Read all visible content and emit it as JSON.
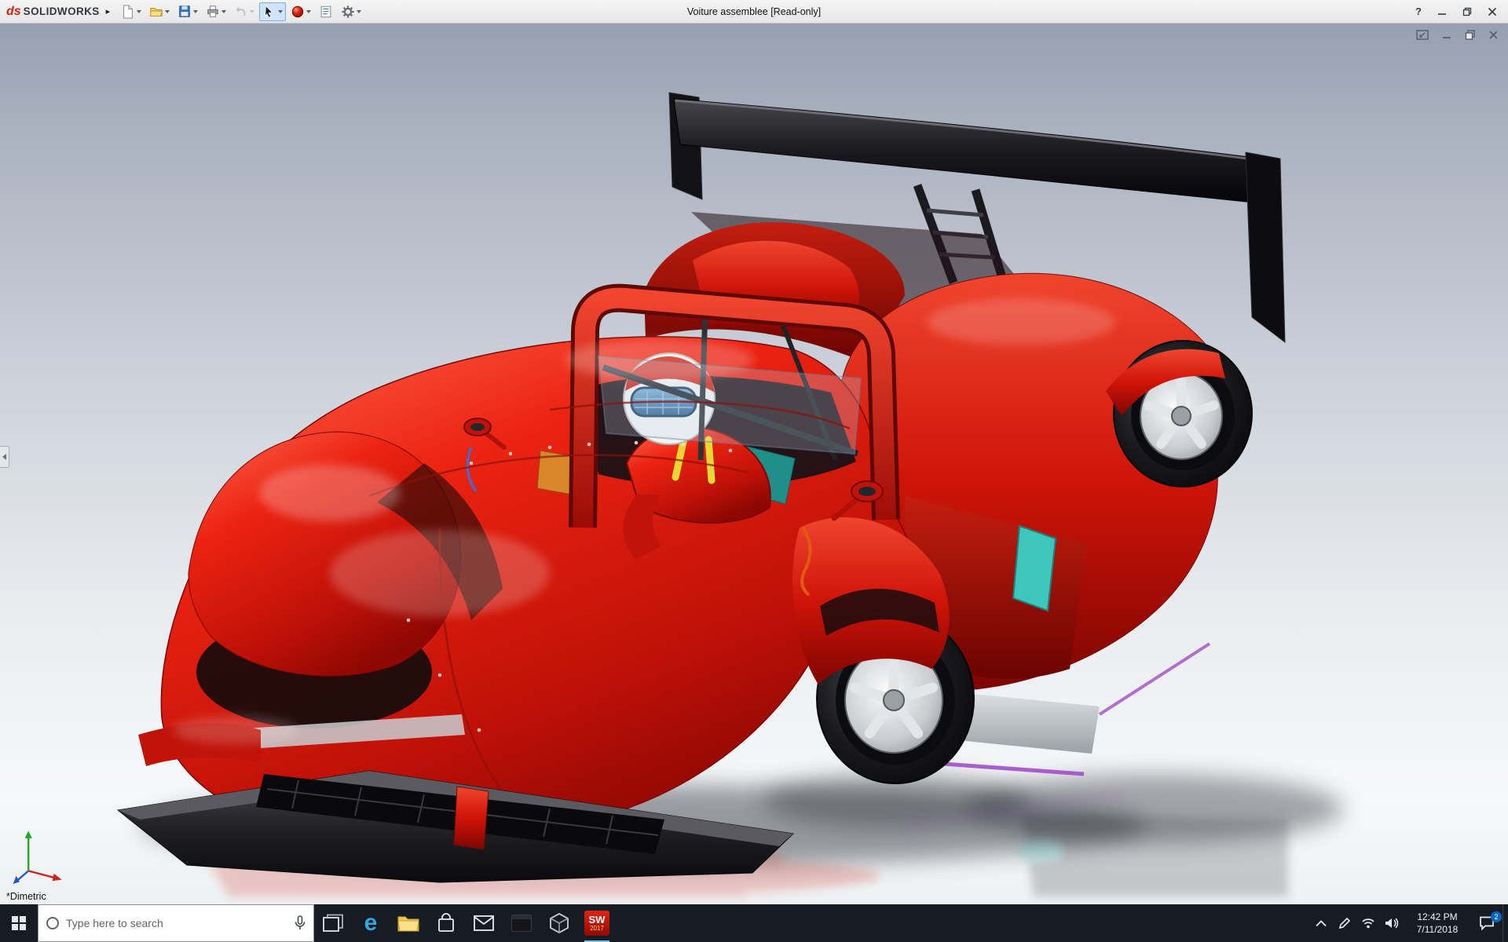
{
  "titlebar": {
    "logo_mark": "ds",
    "logo_text": "SOLIDWORKS",
    "flyout_glyph": "▸",
    "title": "Voiture assemblee [Read-only]",
    "help_glyph": "?"
  },
  "toolbar_icon_names": [
    "new-document",
    "open",
    "save",
    "print",
    "undo",
    "select",
    "appearances",
    "design-binder",
    "options"
  ],
  "viewport": {
    "orientation_label": "*Dimetric",
    "model_description": "red open-cockpit race car assembly with rear wing and driver"
  },
  "taskbar": {
    "search_placeholder": "Type here to search",
    "edge_letter": "e",
    "sw_text": "SW",
    "sw_year": "2017",
    "time": "12:42 PM",
    "date": "7/11/2018",
    "notification_count": "2",
    "icon_names": [
      "start",
      "search",
      "task-view",
      "edge",
      "file-explorer",
      "store",
      "mail",
      "console",
      "3d-viewer",
      "solidworks"
    ],
    "tray_icon_names": [
      "hidden-icons",
      "pen",
      "network",
      "volume",
      "clock",
      "action-center",
      "show-desktop"
    ]
  },
  "colors": {
    "car_red": "#d9220f",
    "wing_black": "#141417",
    "accent_teal": "#3ec6bd",
    "accent_purple": "#a14fc9",
    "selection_highlight": "#cfe4f7",
    "taskbar_bg": "#171c24"
  }
}
